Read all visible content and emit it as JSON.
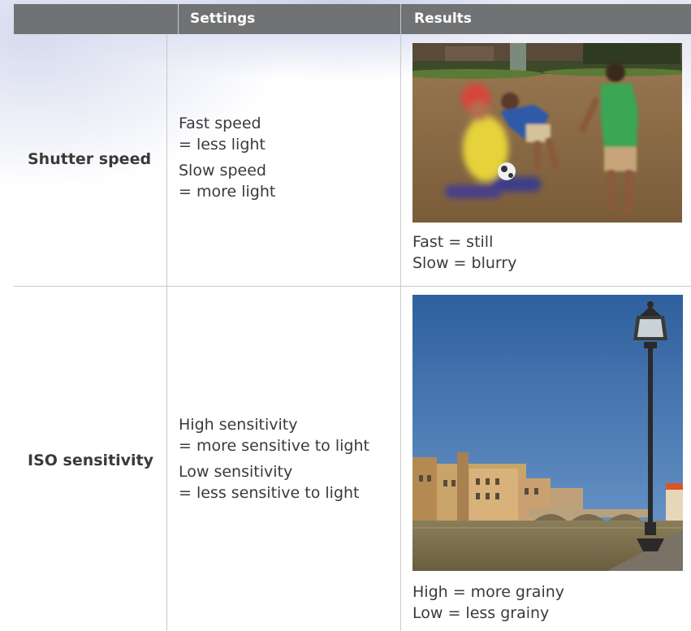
{
  "table": {
    "headers": {
      "settings": "Settings",
      "results": "Results"
    },
    "rows": [
      {
        "label": "Shutter speed",
        "settings": {
          "line1": "Fast speed",
          "line2": "= less light",
          "line3": "Slow speed",
          "line4": "= more light"
        },
        "results": {
          "caption1": "Fast = still",
          "caption2": "Slow = blurry"
        }
      },
      {
        "label": "ISO sensitivity",
        "settings": {
          "line1": "High sensitivity",
          "line2": "= more sensitive to light",
          "line3": "Low sensitivity",
          "line4": "= less sensitive to light"
        },
        "results": {
          "caption1": "High = more grainy",
          "caption2": "Low = less grainy"
        }
      }
    ]
  }
}
